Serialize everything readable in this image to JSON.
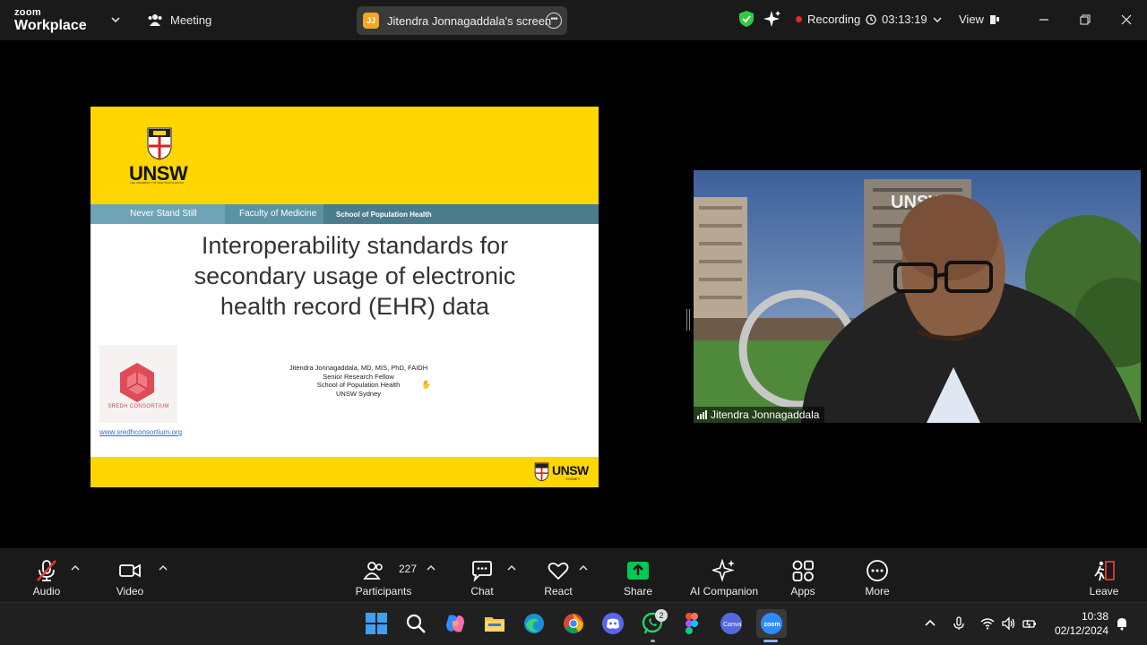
{
  "app": {
    "brand_line1": "zoom",
    "brand_line2": "Workplace",
    "meeting_label": "Meeting"
  },
  "share_pill": {
    "initials": "JJ",
    "label": "Jitendra Jonnagaddala's screen"
  },
  "status": {
    "recording_label": "Recording",
    "timer": "03:13:19",
    "view_label": "View"
  },
  "slide": {
    "logo": "UNSW",
    "logo_small": "THE UNIVERSITY OF NEW SOUTH WALES",
    "nav": [
      "Never Stand Still",
      "Faculty of Medicine",
      "School of Population Health"
    ],
    "title_lines": [
      "Interoperability standards for",
      "secondary usage of  electronic",
      "health record (EHR) data"
    ],
    "consortium_label": "SREDH CONSORTIUM",
    "consortium_link": "www.sredhconsortium.org",
    "author_lines": [
      "Jitendra Jonnagaddala, MD, MIS, PhD, FAIDH",
      "Senior Research Fellow",
      "School of Population Health",
      "UNSW Sydney"
    ],
    "footer_logo": "UNSW",
    "footer_logo_sub": "SYDNEY"
  },
  "video": {
    "participant_name": "Jitendra Jonnagaddala"
  },
  "toolbar": {
    "audio": "Audio",
    "video": "Video",
    "participants": "Participants",
    "participants_count": "227",
    "chat": "Chat",
    "react": "React",
    "share": "Share",
    "ai_companion": "AI Companion",
    "apps": "Apps",
    "more": "More",
    "leave": "Leave"
  },
  "taskbar": {
    "whatsapp_badge": "2",
    "time": "10:38",
    "date": "02/12/2024"
  },
  "colors": {
    "slide_yellow": "#ffd600",
    "nav_teal": "#4a7c8c",
    "share_green": "#00c853",
    "recording_red": "#e02a2a"
  }
}
